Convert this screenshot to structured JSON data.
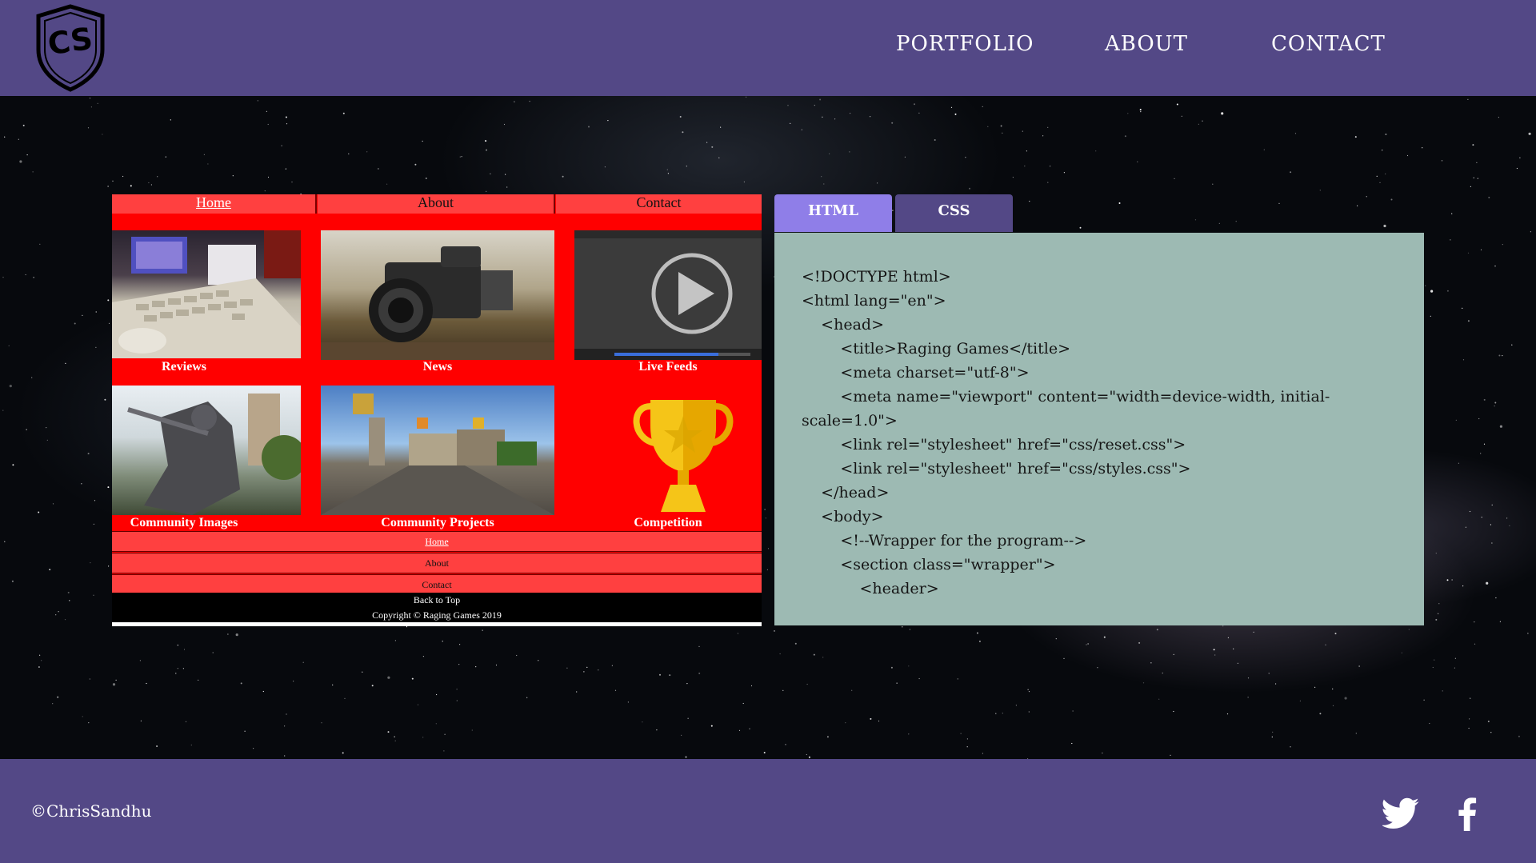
{
  "header": {
    "logo_text": "CS",
    "nav": [
      "PORTFOLIO",
      "ABOUT",
      "CONTACT"
    ]
  },
  "preview": {
    "nav": [
      "Home",
      "About",
      "Contact"
    ],
    "tiles": [
      {
        "caption": "Reviews",
        "image": "retro-keyboard-photo"
      },
      {
        "caption": "News",
        "image": "video-camera-photo"
      },
      {
        "caption": "Live Feeds",
        "image": "video-player-play-icon"
      },
      {
        "caption": "Community Images",
        "image": "armored-knight-statue-photo"
      },
      {
        "caption": "Community Projects",
        "image": "blocky-village-screenshot"
      },
      {
        "caption": "Competition",
        "image": "gold-trophy-icon"
      }
    ],
    "footer_nav": [
      "Home",
      "About",
      "Contact"
    ],
    "back_to_top": "Back to Top",
    "copyright": "Copyright © Raging Games 2019",
    "colors": {
      "accent_red": "#ff0000",
      "nav_red": "#ff4040"
    }
  },
  "code_panel": {
    "tabs": [
      "HTML",
      "CSS"
    ],
    "active_tab": "HTML",
    "code": "<!DOCTYPE html>\n<html lang=\"en\">\n    <head>\n        <title>Raging Games</title>\n        <meta charset=\"utf-8\">\n        <meta name=\"viewport\" content=\"width=device-width, initial-scale=1.0\">\n        <link rel=\"stylesheet\" href=\"css/reset.css\">\n        <link rel=\"stylesheet\" href=\"css/styles.css\">\n    </head>\n    <body>\n        <!--Wrapper for the program-->\n        <section class=\"wrapper\">\n            <header>",
    "colors": {
      "active_tab": "#8f7ee8",
      "inactive_tab": "#534886",
      "panel_bg": "#9dbab3"
    }
  },
  "footer": {
    "credit": "©ChrisSandhu",
    "social_icons": [
      "twitter-icon",
      "facebook-icon"
    ]
  },
  "colors": {
    "brand_purple": "#534886"
  }
}
